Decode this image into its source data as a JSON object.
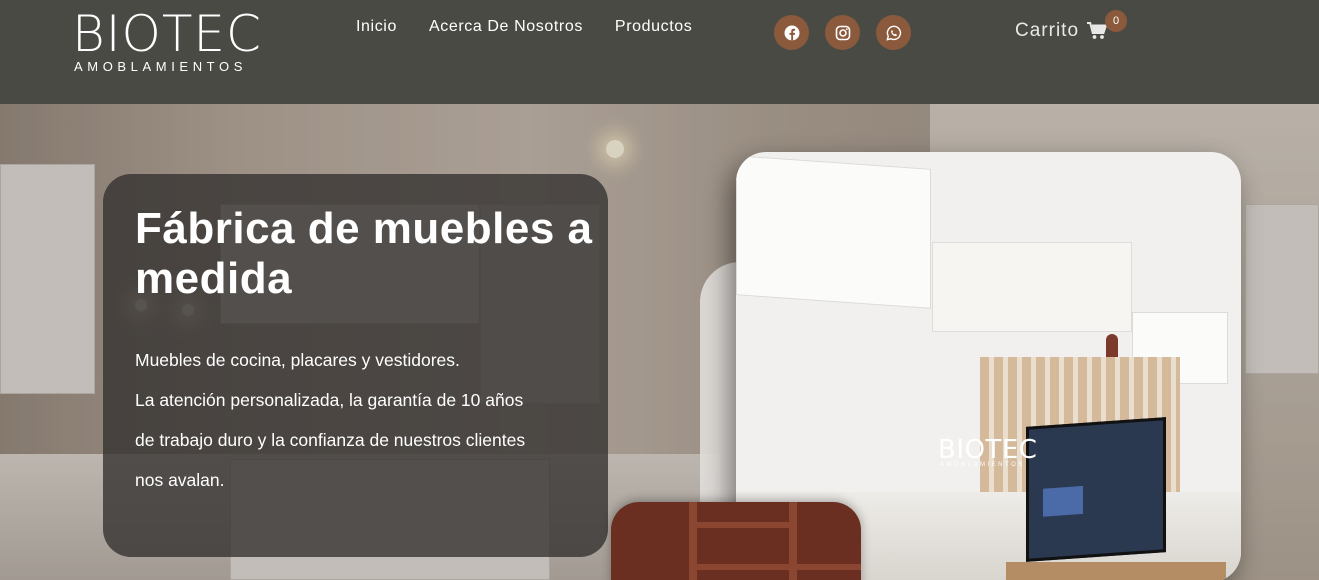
{
  "brand": {
    "name": "BIOTEC",
    "tagline": "AMOBLAMIENTOS"
  },
  "nav": {
    "items": [
      {
        "label": "Inicio"
      },
      {
        "label": "Acerca De Nosotros"
      },
      {
        "label": "Productos"
      }
    ]
  },
  "socials": [
    {
      "icon": "facebook-icon"
    },
    {
      "icon": "instagram-icon"
    },
    {
      "icon": "whatsapp-icon"
    }
  ],
  "cart": {
    "label": "Carrito",
    "count": "0",
    "icon": "shopping-cart-icon"
  },
  "hero": {
    "title": "Fábrica de muebles a medida",
    "lines": [
      "Muebles de cocina, placares y vestidores.",
      "La atención personalizada, la garantía de 10 años",
      "de trabajo duro y la confianza de nuestros clientes",
      "nos avalan."
    ]
  },
  "photo_logo": {
    "name": "BIOTEC",
    "tagline": "AMOBLAMIENTOS"
  },
  "colors": {
    "header_bg": "#4a4a44",
    "accent": "#8b5a3c",
    "text": "#ffffff"
  }
}
